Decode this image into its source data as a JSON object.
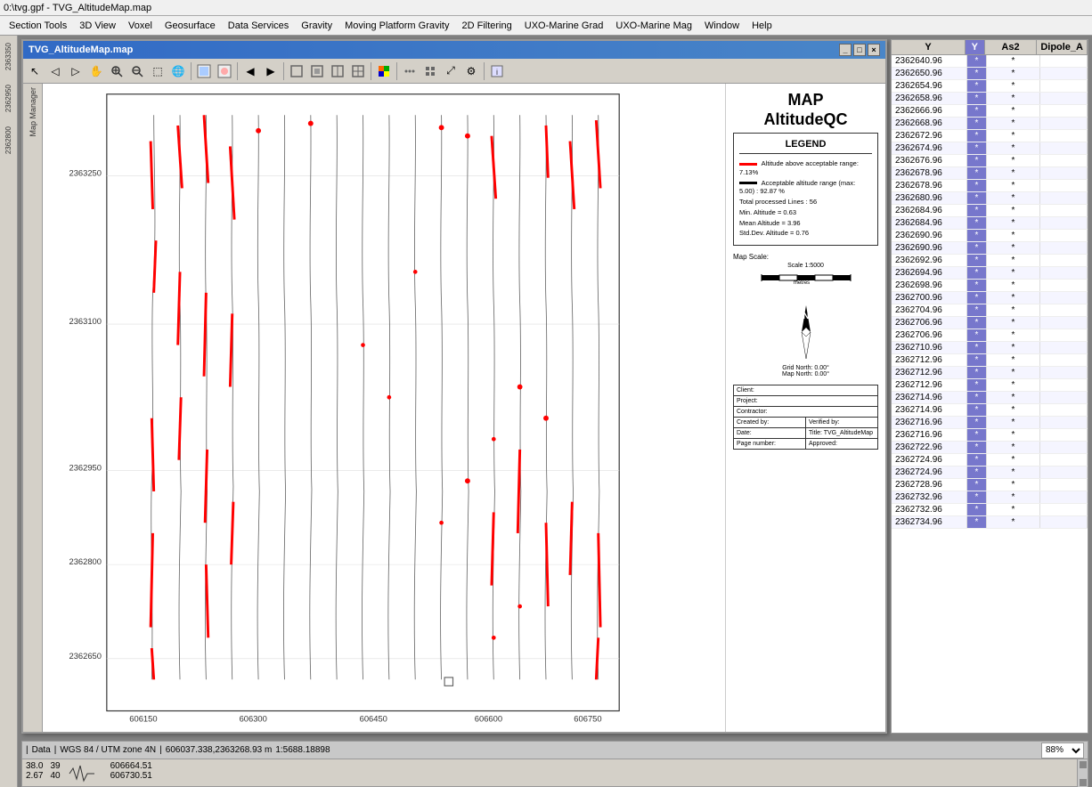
{
  "app": {
    "title_bar": "0:\\tvg.gpf - TVG_AltitudeMap.map",
    "menus": [
      "Section Tools",
      "3D View",
      "Voxel",
      "Geosurface",
      "Data Services",
      "Gravity",
      "Moving Platform Gravity",
      "2D Filtering",
      "UXO-Marine Grad",
      "UXO-Marine Mag",
      "Window",
      "Help"
    ]
  },
  "map_window": {
    "title": "TVG_AltitudeMap.map",
    "toolbar_buttons": [
      {
        "name": "pointer",
        "icon": "↖"
      },
      {
        "name": "back",
        "icon": "←"
      },
      {
        "name": "forward",
        "icon": "→"
      },
      {
        "name": "hand",
        "icon": "✋"
      },
      {
        "name": "zoom-in",
        "icon": "🔍"
      },
      {
        "name": "zoom-out",
        "icon": "🔎"
      },
      {
        "name": "zoom-rect",
        "icon": "⬚"
      },
      {
        "name": "globe",
        "icon": "🌐"
      },
      {
        "name": "export1",
        "icon": "📤"
      },
      {
        "name": "export2",
        "icon": "📥"
      },
      {
        "name": "prev",
        "icon": "◀"
      },
      {
        "name": "next",
        "icon": "▶"
      },
      {
        "name": "frame1",
        "icon": "▢"
      },
      {
        "name": "frame2",
        "icon": "▣"
      },
      {
        "name": "frame3",
        "icon": "▤"
      },
      {
        "name": "frame4",
        "icon": "▥"
      },
      {
        "name": "color",
        "icon": "🎨"
      },
      {
        "name": "grid1",
        "icon": "⊞"
      },
      {
        "name": "grid2",
        "icon": "⊟"
      },
      {
        "name": "move",
        "icon": "⤢"
      },
      {
        "name": "settings",
        "icon": "⚙"
      },
      {
        "name": "info",
        "icon": "ℹ"
      }
    ]
  },
  "legend": {
    "map_title": "MAP",
    "map_subtitle": "AltitudeQC",
    "legend_title": "LEGEND",
    "items": [
      {
        "color": "red",
        "label": "Altitude above acceptable range: 7.13%"
      },
      {
        "color": "black",
        "label": "Acceptable altitude range (max: 5.00) : 92.87 %"
      },
      {
        "label": "Total processed Lines : 56"
      },
      {
        "label": "Min. Altitude = 0.63"
      },
      {
        "label": "Mean Altitude = 3.96"
      },
      {
        "label": "Std.Dev. Altitude = 0.76"
      }
    ],
    "map_scale_label": "Map Scale:",
    "scale_value": "Scale 1:5000",
    "north_label": "N",
    "grid_north": "Grid North: 0.00°",
    "map_north": "Map North: 0.00°",
    "footer": {
      "client_label": "Client:",
      "project_label": "Project:",
      "contractor_label": "Contractor:",
      "created_by": "Created by:",
      "verified_by": "Verified by:",
      "date_label": "Date:",
      "title_label": "Title: TVG_AltitudeMap",
      "page_number_label": "Page number:",
      "approved_label": "Approved:"
    }
  },
  "map_axes": {
    "x_labels": [
      "606150",
      "606300",
      "606450",
      "606600",
      "606750"
    ],
    "y_labels": [
      "2362650",
      "2362800",
      "2362950",
      "2363100",
      "2363250"
    ]
  },
  "data_table": {
    "columns": [
      "Y",
      "Y",
      "As2",
      "Dipole_A"
    ],
    "col_y_header": "Y",
    "col_y2_header": "Y",
    "col_as2_header": "As2",
    "col_dipole_header": "Dipole_A",
    "rows": [
      {
        "y": "2362640.96",
        "y2": "*",
        "as2": "*",
        "dipole": ""
      },
      {
        "y": "2362650.96",
        "y2": "*",
        "as2": "*",
        "dipole": ""
      },
      {
        "y": "2362654.96",
        "y2": "*",
        "as2": "*",
        "dipole": ""
      },
      {
        "y": "2362658.96",
        "y2": "*",
        "as2": "*",
        "dipole": ""
      },
      {
        "y": "2362666.96",
        "y2": "*",
        "as2": "*",
        "dipole": ""
      },
      {
        "y": "2362668.96",
        "y2": "*",
        "as2": "*",
        "dipole": ""
      },
      {
        "y": "2362672.96",
        "y2": "*",
        "as2": "*",
        "dipole": ""
      },
      {
        "y": "2362674.96",
        "y2": "*",
        "as2": "*",
        "dipole": ""
      },
      {
        "y": "2362676.96",
        "y2": "*",
        "as2": "*",
        "dipole": ""
      },
      {
        "y": "2362678.96",
        "y2": "*",
        "as2": "*",
        "dipole": ""
      },
      {
        "y": "2362678.96",
        "y2": "*",
        "as2": "*",
        "dipole": ""
      },
      {
        "y": "2362680.96",
        "y2": "*",
        "as2": "*",
        "dipole": ""
      },
      {
        "y": "2362684.96",
        "y2": "*",
        "as2": "*",
        "dipole": ""
      },
      {
        "y": "2362684.96",
        "y2": "*",
        "as2": "*",
        "dipole": ""
      },
      {
        "y": "2362690.96",
        "y2": "*",
        "as2": "*",
        "dipole": ""
      },
      {
        "y": "2362690.96",
        "y2": "*",
        "as2": "*",
        "dipole": ""
      },
      {
        "y": "2362692.96",
        "y2": "*",
        "as2": "*",
        "dipole": ""
      },
      {
        "y": "2362694.96",
        "y2": "*",
        "as2": "*",
        "dipole": ""
      },
      {
        "y": "2362698.96",
        "y2": "*",
        "as2": "*",
        "dipole": ""
      },
      {
        "y": "2362700.96",
        "y2": "*",
        "as2": "*",
        "dipole": ""
      },
      {
        "y": "2362704.96",
        "y2": "*",
        "as2": "*",
        "dipole": ""
      },
      {
        "y": "2362706.96",
        "y2": "*",
        "as2": "*",
        "dipole": ""
      },
      {
        "y": "2362706.96",
        "y2": "*",
        "as2": "*",
        "dipole": ""
      },
      {
        "y": "2362710.96",
        "y2": "*",
        "as2": "*",
        "dipole": ""
      },
      {
        "y": "2362712.96",
        "y2": "*",
        "as2": "*",
        "dipole": ""
      },
      {
        "y": "2362712.96",
        "y2": "*",
        "as2": "*",
        "dipole": ""
      },
      {
        "y": "2362712.96",
        "y2": "*",
        "as2": "*",
        "dipole": ""
      },
      {
        "y": "2362714.96",
        "y2": "*",
        "as2": "*",
        "dipole": ""
      },
      {
        "y": "2362714.96",
        "y2": "*",
        "as2": "*",
        "dipole": ""
      },
      {
        "y": "2362716.96",
        "y2": "*",
        "as2": "*",
        "dipole": ""
      },
      {
        "y": "2362716.96",
        "y2": "*",
        "as2": "*",
        "dipole": ""
      },
      {
        "y": "2362722.96",
        "y2": "*",
        "as2": "*",
        "dipole": ""
      },
      {
        "y": "2362724.96",
        "y2": "*",
        "as2": "*",
        "dipole": ""
      },
      {
        "y": "2362724.96",
        "y2": "*",
        "as2": "*",
        "dipole": ""
      },
      {
        "y": "2362728.96",
        "y2": "*",
        "as2": "*",
        "dipole": ""
      },
      {
        "y": "2362732.96",
        "y2": "*",
        "as2": "*",
        "dipole": ""
      },
      {
        "y": "2362732.96",
        "y2": "*",
        "as2": "*",
        "dipole": ""
      },
      {
        "y": "2362734.96",
        "y2": "*",
        "as2": "*",
        "dipole": ""
      }
    ]
  },
  "status_bar": {
    "data_label": "Data",
    "crs": "WGS 84 / UTM zone 4N",
    "coordinates": "606037.338,2363268.93 m",
    "scale": "1:5688.18898",
    "zoom": "88%",
    "bottom_row1_col1": "38.0",
    "bottom_row1_col2": "39",
    "bottom_row1_col3": "606664.51",
    "bottom_row2_col1": "2.67",
    "bottom_row2_col2": "40",
    "bottom_row2_col3": "606730.51"
  },
  "left_vert_labels": [
    "2363350",
    "2362950",
    "2362800"
  ],
  "map_manager_label": "Map Manager"
}
